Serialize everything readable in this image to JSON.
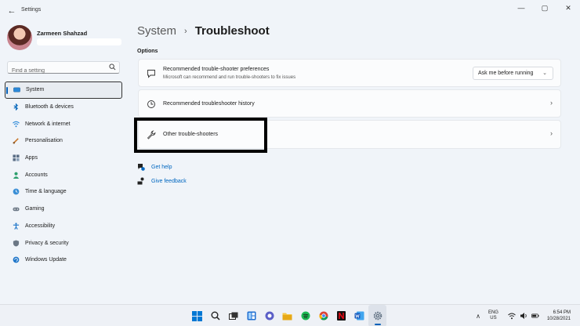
{
  "app": {
    "title": "Settings"
  },
  "profile": {
    "name": "Zarmeen Shahzad"
  },
  "search": {
    "placeholder": "Find a setting"
  },
  "sidebar": {
    "items": [
      {
        "label": "System",
        "icon": "monitor-icon"
      },
      {
        "label": "Bluetooth & devices",
        "icon": "bluetooth-icon"
      },
      {
        "label": "Network & internet",
        "icon": "wifi-icon"
      },
      {
        "label": "Personalisation",
        "icon": "brush-icon"
      },
      {
        "label": "Apps",
        "icon": "apps-icon"
      },
      {
        "label": "Accounts",
        "icon": "person-icon"
      },
      {
        "label": "Time & language",
        "icon": "globe-clock-icon"
      },
      {
        "label": "Gaming",
        "icon": "gamepad-icon"
      },
      {
        "label": "Accessibility",
        "icon": "accessibility-icon"
      },
      {
        "label": "Privacy & security",
        "icon": "shield-icon"
      },
      {
        "label": "Windows Update",
        "icon": "update-icon"
      }
    ]
  },
  "breadcrumb": {
    "parent": "System",
    "current": "Troubleshoot"
  },
  "options": {
    "label": "Options",
    "preferences": {
      "title": "Recommended trouble-shooter preferences",
      "subtitle": "Microsoft can recommend and run trouble-shooters to fix issues",
      "dropdown_value": "Ask me before running"
    },
    "history": {
      "title": "Recommended troubleshooter history"
    },
    "other": {
      "title": "Other trouble-shooters"
    }
  },
  "links": {
    "get_help": "Get help",
    "give_feedback": "Give feedback"
  },
  "tray": {
    "lang_line1": "ENG",
    "lang_line2": "US",
    "time": "6:54 PM",
    "date": "10/28/2021"
  },
  "colors": {
    "accent": "#005fb8",
    "link": "#0067c0",
    "highlight_border": "#000000"
  }
}
